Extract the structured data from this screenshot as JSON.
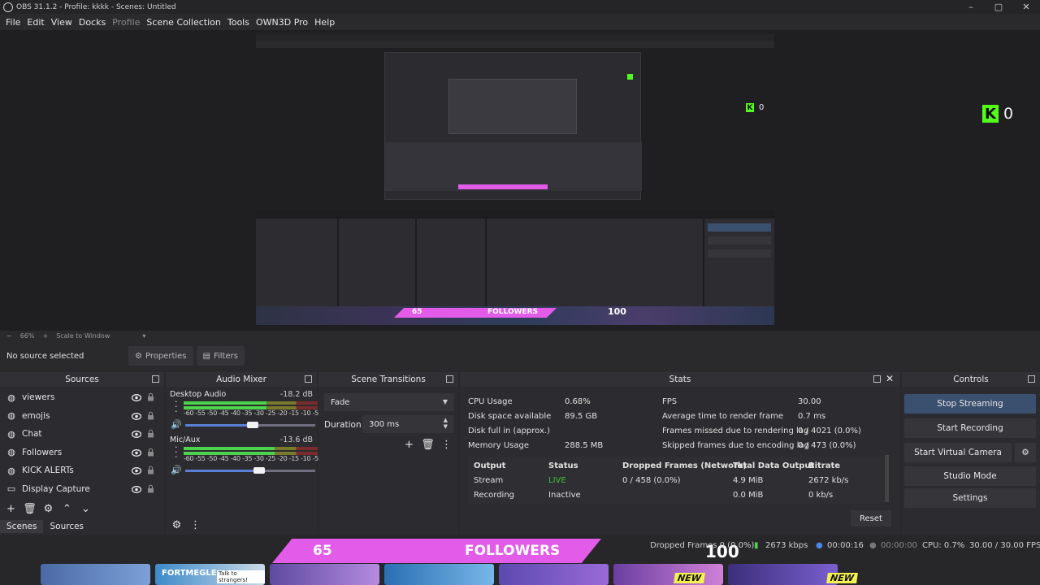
{
  "window": {
    "title": "OBS 31.1.2 - Profile: kkkk - Scenes: Untitled",
    "controls": [
      "–",
      "▢",
      "✕"
    ]
  },
  "menu": [
    {
      "label": "File",
      "disabled": false
    },
    {
      "label": "Edit",
      "disabled": false
    },
    {
      "label": "View",
      "disabled": false
    },
    {
      "label": "Docks",
      "disabled": false
    },
    {
      "label": "Profile",
      "disabled": true
    },
    {
      "label": "Scene Collection",
      "disabled": false
    },
    {
      "label": "Tools",
      "disabled": false
    },
    {
      "label": "OWN3D Pro",
      "disabled": false
    },
    {
      "label": "Help",
      "disabled": false
    }
  ],
  "preview": {
    "kick_count": "0",
    "zoom": "66%",
    "scale_mode": "Scale to Window"
  },
  "source_toolbar": {
    "no_source": "No source selected",
    "properties": "Properties",
    "filters": "Filters"
  },
  "sources": {
    "title": "Sources",
    "items": [
      {
        "label": "viewers",
        "icon": "globe-icon"
      },
      {
        "label": "emojis",
        "icon": "globe-icon"
      },
      {
        "label": "Chat",
        "icon": "globe-icon"
      },
      {
        "label": "Followers",
        "icon": "globe-icon"
      },
      {
        "label": "KICK ALERTs",
        "icon": "globe-icon"
      },
      {
        "label": "Display Capture",
        "icon": "monitor-icon"
      }
    ],
    "tabs": [
      "Scenes",
      "Sources"
    ]
  },
  "mixer": {
    "title": "Audio Mixer",
    "scale": "-60 -55 -50 -45 -40 -35 -30 -25 -20 -15 -10 -5  0",
    "channels": [
      {
        "name": "Desktop Audio",
        "db": "-18.2 dB",
        "level": 0.62,
        "volume": 0.52
      },
      {
        "name": "Mic/Aux",
        "db": "-13.6 dB",
        "level": 0.68,
        "volume": 0.57
      }
    ]
  },
  "transitions": {
    "title": "Scene Transitions",
    "transition": "Fade",
    "duration_label": "Duration",
    "duration": "300 ms"
  },
  "stats": {
    "title": "Stats",
    "left": [
      {
        "label": "CPU Usage",
        "value": "0.68%"
      },
      {
        "label": "Disk space available",
        "value": "89.5 GB"
      },
      {
        "label": "Disk full in (approx.)",
        "value": ""
      },
      {
        "label": "Memory Usage",
        "value": "288.5 MB"
      }
    ],
    "right": [
      {
        "label": "FPS",
        "value": "30.00"
      },
      {
        "label": "Average time to render frame",
        "value": "0.7 ms"
      },
      {
        "label": "Frames missed due to rendering lag",
        "value": "0 / 4021 (0.0%)"
      },
      {
        "label": "Skipped frames due to encoding lag",
        "value": "0 / 473 (0.0%)"
      }
    ],
    "output_headers": [
      "Output",
      "Status",
      "Dropped Frames (Network)",
      "Total Data Output",
      "Bitrate"
    ],
    "outputs": [
      {
        "output": "Stream",
        "status": "LIVE",
        "dropped": "0 / 458 (0.0%)",
        "total": "4.9 MiB",
        "bitrate": "2672 kb/s"
      },
      {
        "output": "Recording",
        "status": "Inactive",
        "dropped": "",
        "total": "0.0 MiB",
        "bitrate": "0 kb/s"
      }
    ],
    "reset": "Reset",
    "live_color": "#3fbf3f"
  },
  "controls": {
    "title": "Controls",
    "buttons": [
      "Stop Streaming",
      "Start Recording",
      "Start Virtual Camera",
      "Studio Mode",
      "Settings"
    ]
  },
  "overlay": {
    "followers_count": "65",
    "followers_label": "FOLLOWERS",
    "followers_goal": "100",
    "accent": "#e35be9",
    "new_tag": "NEW",
    "game_title": "FORTMEGLE",
    "game_subtitle": "Talk to strangers!"
  },
  "statusbar": {
    "dropped": "Dropped Frames 0 (0.0%)",
    "bitrate": "2673 kbps",
    "stream_time": "00:00:16",
    "rec_time": "00:00:00",
    "cpu": "CPU: 0.7%",
    "fps": "30.00 / 30.00 FPS"
  }
}
